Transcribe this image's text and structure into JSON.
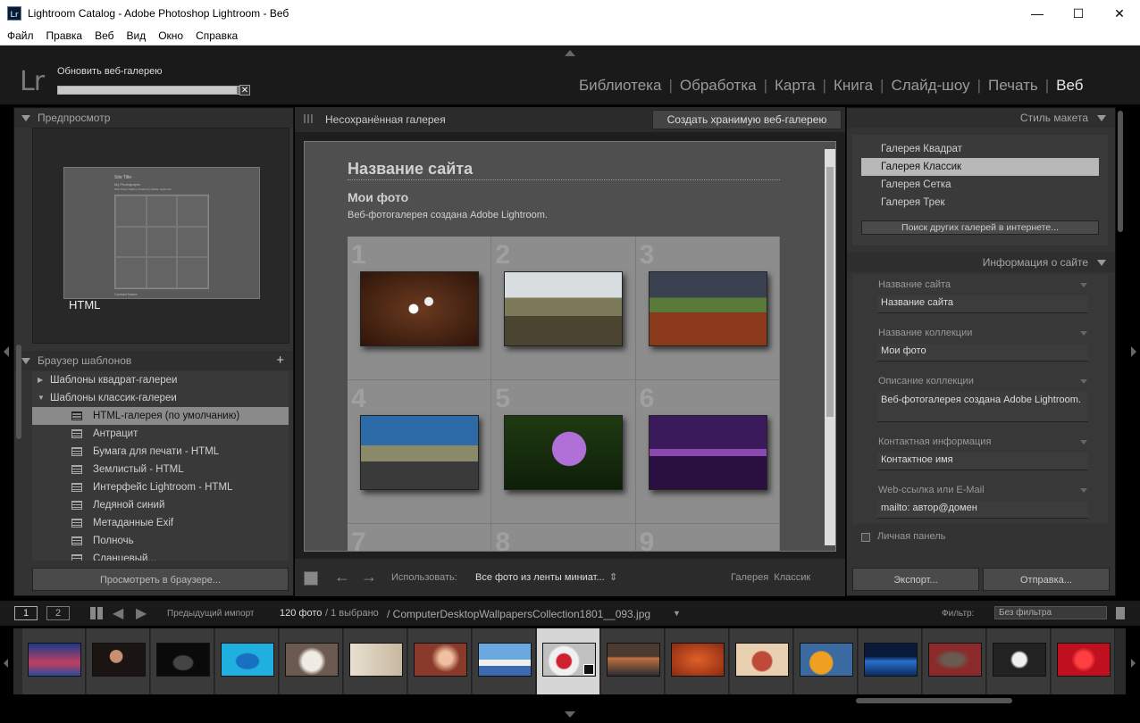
{
  "window": {
    "title": "Lightroom Catalog - Adobe Photoshop Lightroom - Веб",
    "min": "—",
    "max": "☐",
    "close": "✕",
    "app_badge": "Lr"
  },
  "menu": [
    "Файл",
    "Правка",
    "Веб",
    "Вид",
    "Окно",
    "Справка"
  ],
  "top": {
    "logo": "Lr",
    "progress_label": "Обновить веб-галерею",
    "progress_fraction": 0.98,
    "progress_close": "✕",
    "modules": [
      "Библиотека",
      "Обработка",
      "Карта",
      "Книга",
      "Слайд-шоу",
      "Печать",
      "Веб"
    ],
    "active_module": "Веб",
    "sep": "|"
  },
  "left": {
    "preview_header": "Предпросмотр",
    "preview_type": "HTML",
    "preview_mini": {
      "title": "Site Title",
      "sub": "My Photographs",
      "desc": "Web Photo Gallery Created by Adobe Lightroom",
      "contact": "Contact Name"
    },
    "templates_header": "Браузер шаблонов",
    "add": "+",
    "folders": [
      {
        "label": "Шаблоны квадрат-галереи",
        "caret": "▶"
      },
      {
        "label": "Шаблоны классик-галереи",
        "caret": "▼"
      }
    ],
    "templates": [
      "HTML-галерея (по умолчанию)",
      "Антрацит",
      "Бумага для печати - HTML",
      "Землистый - HTML",
      "Интерфейс Lightroom - HTML",
      "Ледяной синий",
      "Метаданные Exif",
      "Полночь",
      "Сланцевый..."
    ],
    "selected_template": "HTML-галерея (по умолчанию)",
    "browser_button": "Просмотреть в браузере..."
  },
  "center": {
    "header_title": "Несохранённая галерея",
    "create_button": "Создать хранимую веб-галерею",
    "site_title": "Название сайта",
    "collection_title": "Мои фото",
    "collection_desc": "Веб-фотогалерея создана Adobe Lightroom.",
    "cell_numbers": [
      "1",
      "2",
      "3",
      "4",
      "5",
      "6",
      "7",
      "8",
      "9"
    ],
    "use_label": "Использовать:",
    "use_value": "Все фото из ленты миниат...",
    "use_arrow": "⇕",
    "nav_prev": "←",
    "nav_next": "→",
    "footer_style": "Галерея  Классик"
  },
  "right": {
    "style_header": "Стиль макета",
    "styles": [
      "Галерея  Квадрат",
      "Галерея  Классик",
      "Галерея  Сетка",
      "Галерея  Трек"
    ],
    "selected_style": "Галерея  Классик",
    "find_button": "Поиск других галерей в интернете...",
    "site_info_header": "Информация о сайте",
    "fields": [
      {
        "label": "Название сайта",
        "value": "Название сайта"
      },
      {
        "label": "Название коллекции",
        "value": "Мои фото"
      },
      {
        "label": "Описание коллекции",
        "value": "Веб-фотогалерея создана Adobe Lightroom."
      },
      {
        "label": "Контактная информация",
        "value": "Контактное имя"
      },
      {
        "label": "Web-ссылка или E-Mail",
        "value": "mailto: автор@домен"
      }
    ],
    "private_panel": "Личная панель",
    "export_button": "Экспорт...",
    "send_button": "Отправка..."
  },
  "filmstrip_bar": {
    "screen1": "1",
    "screen2": "2",
    "prev_import": "Предыдущий импорт",
    "count": "120 фото",
    "selected": "/ 1 выбрано",
    "path": "/ ComputerDesktopWallpapersCollection1801__093.jpg",
    "path_arrow": "▼",
    "filter_label": "Фильтр:",
    "filter_value": "Без фильтра"
  }
}
